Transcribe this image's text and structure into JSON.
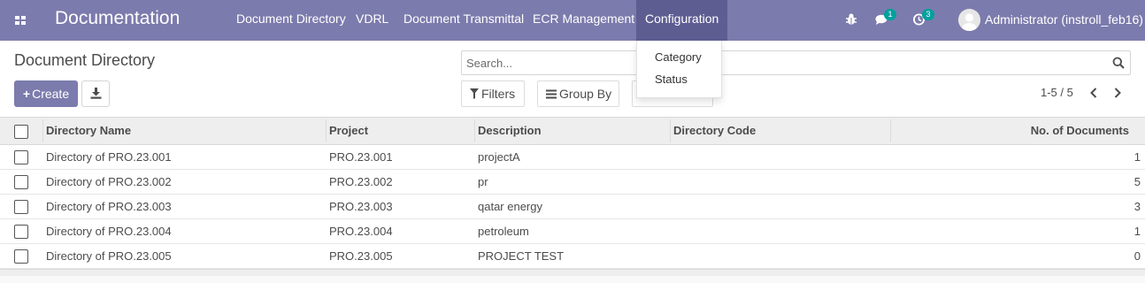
{
  "navbar": {
    "app_title": "Documentation",
    "menu": [
      {
        "label": "Document Directory"
      },
      {
        "label": "VDRL"
      },
      {
        "label": "Document Transmittal"
      },
      {
        "label": "ECR Management"
      },
      {
        "label": "Configuration"
      }
    ],
    "messages_count": "1",
    "activities_count": "3",
    "user_name": "Administrator (instroll_feb16)",
    "bar_color": "#7c7bad"
  },
  "control_panel": {
    "page_title": "Document Directory",
    "create_label": "Create",
    "search_placeholder": "Search...",
    "filters_label": "Filters",
    "group_by_label": "Group By",
    "pager_value": "1-5 / 5"
  },
  "dropdown": {
    "items": [
      {
        "label": "Category"
      },
      {
        "label": "Status"
      }
    ]
  },
  "table": {
    "columns": [
      "Directory Name",
      "Project",
      "Description",
      "Directory Code",
      "No. of Documents"
    ],
    "rows": [
      {
        "name": "Directory of PRO.23.001",
        "project": "PRO.23.001",
        "description": "projectA",
        "code": "",
        "count": "1"
      },
      {
        "name": "Directory of PRO.23.002",
        "project": "PRO.23.002",
        "description": "pr",
        "code": "",
        "count": "5"
      },
      {
        "name": "Directory of PRO.23.003",
        "project": "PRO.23.003",
        "description": "qatar energy",
        "code": "",
        "count": "3"
      },
      {
        "name": "Directory of PRO.23.004",
        "project": "PRO.23.004",
        "description": "petroleum",
        "code": "",
        "count": "1"
      },
      {
        "name": "Directory of PRO.23.005",
        "project": "PRO.23.005",
        "description": "PROJECT TEST",
        "code": "",
        "count": "0"
      }
    ]
  },
  "icons": {
    "apps": "apps-grid-icon",
    "debug": "bug-icon",
    "messages": "chat-icon",
    "activities": "clock-icon",
    "download": "download-icon",
    "search": "search-icon",
    "filter": "filter-icon",
    "group_by": "list-icon",
    "pager_prev": "chevron-left-icon",
    "pager_next": "chevron-right-icon"
  }
}
